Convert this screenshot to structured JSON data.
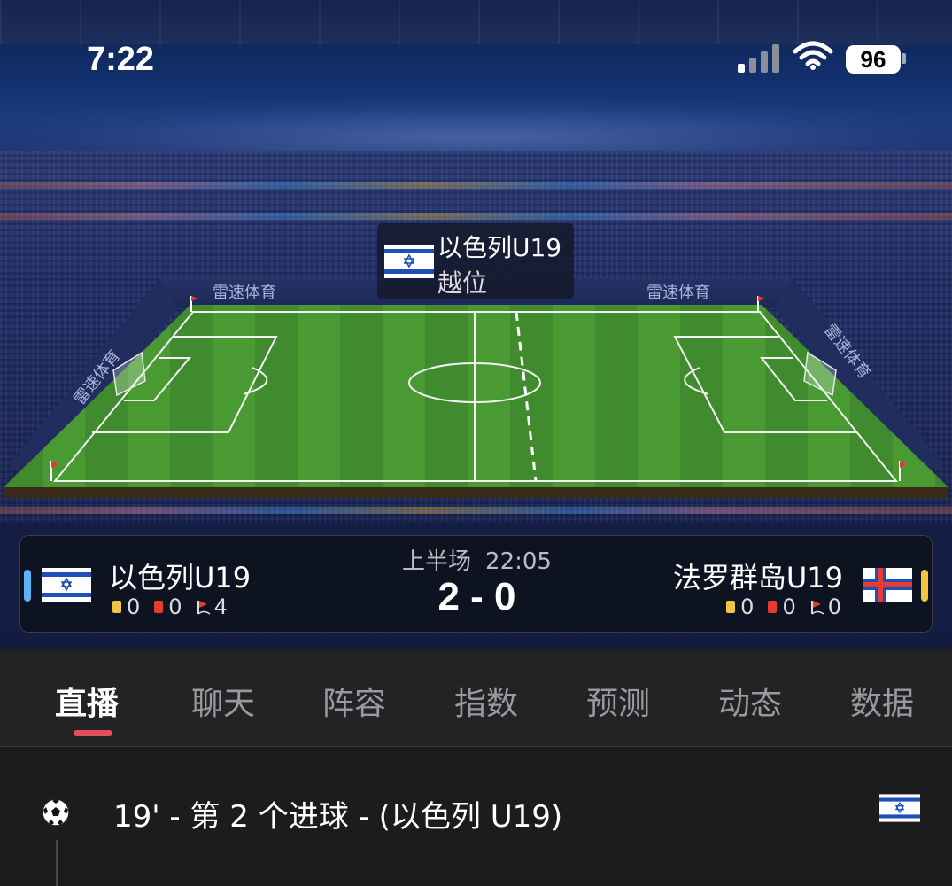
{
  "status_bar": {
    "time": "7:22",
    "battery": "96",
    "icons": [
      "signal-icon",
      "wifi-icon",
      "battery-icon"
    ]
  },
  "stadium": {
    "sponsor_text": "雷速体育"
  },
  "event_tooltip": {
    "team": "以色列U19",
    "event": "越位"
  },
  "match": {
    "period": "上半场",
    "clock": "22:05",
    "score": "2 - 0",
    "home": {
      "name": "以色列U19",
      "yellow_cards": "0",
      "red_cards": "0",
      "corners": "4",
      "color": "#5ab4f5"
    },
    "away": {
      "name": "法罗群岛U19",
      "yellow_cards": "0",
      "red_cards": "0",
      "corners": "0",
      "color": "#f0c640"
    }
  },
  "tabs": [
    {
      "label": "直播",
      "active": true
    },
    {
      "label": "聊天",
      "active": false
    },
    {
      "label": "阵容",
      "active": false
    },
    {
      "label": "指数",
      "active": false
    },
    {
      "label": "预测",
      "active": false
    },
    {
      "label": "动态",
      "active": false
    },
    {
      "label": "数据",
      "active": false
    }
  ],
  "feed": {
    "items": [
      {
        "text": "19' - 第 2 个进球 - (以色列 U19)",
        "icon": "soccer-ball-icon",
        "team_flag": "israel-flag-icon"
      }
    ]
  },
  "colors": {
    "accent_underline": "#e0505a",
    "pitch_green": "#3f8a2c"
  }
}
